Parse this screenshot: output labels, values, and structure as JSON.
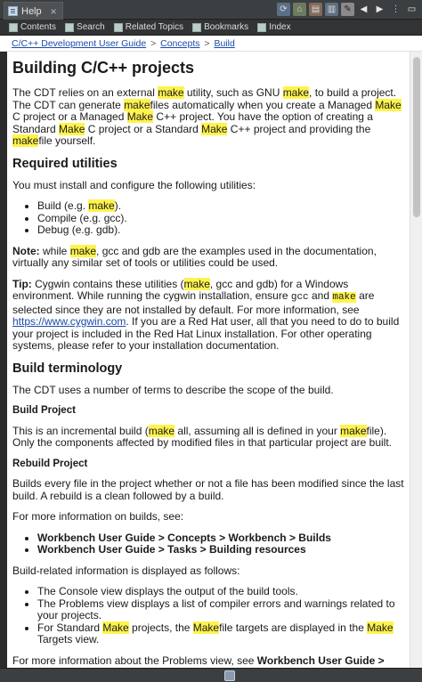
{
  "view": {
    "tab_label": "Help",
    "close_glyph": "×"
  },
  "toolbar_icons": [
    "sync-icon",
    "home-icon",
    "print-icon",
    "book-icon",
    "highlight-icon",
    "back-icon",
    "forward-icon",
    "view-menu-icon",
    "minimize-icon"
  ],
  "navtabs": [
    {
      "label": "Contents",
      "icon": "contents-icon"
    },
    {
      "label": "Search",
      "icon": "search-icon"
    },
    {
      "label": "Related Topics",
      "icon": "related-topics-icon"
    },
    {
      "label": "Bookmarks",
      "icon": "bookmarks-icon"
    },
    {
      "label": "Index",
      "icon": "index-icon"
    }
  ],
  "breadcrumb": [
    "C/C++ Development User Guide",
    "Concepts",
    "Build"
  ],
  "doc": {
    "title": "Building C/C++ projects",
    "intro": [
      "The CDT relies on an external ",
      "make",
      " utility, such as GNU ",
      "make",
      ", to build a project. The CDT can generate ",
      "make",
      "files automatically when you create a Managed ",
      "Make",
      " C project or a Managed ",
      "Make",
      " C++ project. You have the option of creating a Standard ",
      "Make",
      " C project or a Standard ",
      "Make",
      " C++ project and providing the ",
      "make",
      "file yourself."
    ],
    "required_heading": "Required utilities",
    "required_text": "You must install and configure the following utilities:",
    "util_build": [
      "Build (e.g. ",
      "make",
      ")."
    ],
    "util_compile": "Compile (e.g. gcc).",
    "util_debug": "Debug (e.g. gdb).",
    "note_label": "Note:",
    "note": [
      " while ",
      "make",
      ", gcc and gdb are the examples used in the documentation, virtually any similar set of tools or utilities could be used."
    ],
    "tip_label": "Tip:",
    "tip": [
      " Cygwin contains these utilities (",
      "make",
      ", gcc and gdb) for a Windows environment. While running the cygwin installation, ensure ",
      "gcc",
      " and ",
      "make",
      " are selected since they are not installed by default. For more information, see ",
      "https://www.cygwin.com",
      ". If you are a Red Hat user, all that you need to do to build your project is included in the Red Hat Linux installation. For other operating systems, please refer to your installation documentation."
    ],
    "terminology_heading": "Build terminology",
    "terminology_text": "The CDT uses a number of terms to describe the scope of the build.",
    "build_project_heading": "Build Project",
    "build_project": [
      "This is an incremental build (",
      "make",
      " all, assuming all is defined in your ",
      "make",
      "file). Only the components affected by modified files in that particular project are built."
    ],
    "rebuild_project_heading": "Rebuild Project",
    "rebuild_project": "Builds every file in the project whether or not a file has been modified since the last build. A rebuild is a clean followed by a build.",
    "more_info": "For more information on builds, see:",
    "ref1": "Workbench User Guide > Concepts > Workbench > Builds",
    "ref2": "Workbench User Guide > Tasks > Building resources",
    "build_info": "Build-related information is displayed as follows:",
    "info_console": "The Console view displays the output of the build tools.",
    "info_problems": "The Problems view displays a list of compiler errors and warnings related to your projects.",
    "info_standard": [
      "For Standard ",
      "Make",
      " projects, the ",
      "Make",
      "file targets are displayed in the ",
      "Make",
      " Targets view."
    ],
    "problems_more": [
      "For more information about the Problems view, see ",
      "Workbench User Guide > Reference > User interface information > Views and editors > Problems view"
    ]
  }
}
